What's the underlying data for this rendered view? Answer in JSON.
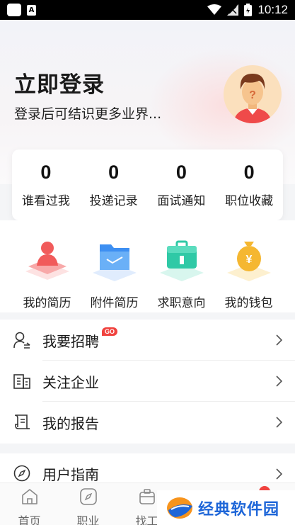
{
  "status_bar": {
    "time": "10:12",
    "notification_letter": "A"
  },
  "header": {
    "title": "立即登录",
    "subtitle": "登录后可结识更多业界..."
  },
  "stats": [
    {
      "value": "0",
      "label": "谁看过我"
    },
    {
      "value": "0",
      "label": "投递记录"
    },
    {
      "value": "0",
      "label": "面试通知"
    },
    {
      "value": "0",
      "label": "职位收藏"
    }
  ],
  "features": [
    {
      "label": "我的简历",
      "icon": "resume-icon",
      "color": "#f15b5b"
    },
    {
      "label": "附件简历",
      "icon": "folder-icon",
      "color": "#3d8ff2"
    },
    {
      "label": "求职意向",
      "icon": "briefcase-icon",
      "color": "#2fc9a6"
    },
    {
      "label": "我的钱包",
      "icon": "wallet-icon",
      "color": "#f5b731"
    }
  ],
  "menu": [
    {
      "label": "我要招聘",
      "badge": "GO",
      "icon": "recruit-icon"
    },
    {
      "label": "关注企业",
      "icon": "company-icon"
    },
    {
      "label": "我的报告",
      "icon": "report-icon"
    },
    {
      "label": "用户指南",
      "icon": "compass-icon"
    }
  ],
  "bottom_nav": [
    {
      "label": "首页",
      "icon": "home-icon"
    },
    {
      "label": "职业",
      "icon": "career-icon"
    },
    {
      "label": "找工",
      "icon": "job-icon"
    }
  ],
  "watermark": {
    "text": "经典软件园"
  },
  "colors": {
    "accent_red": "#f0433f",
    "watermark_blue": "#1e66d8"
  }
}
